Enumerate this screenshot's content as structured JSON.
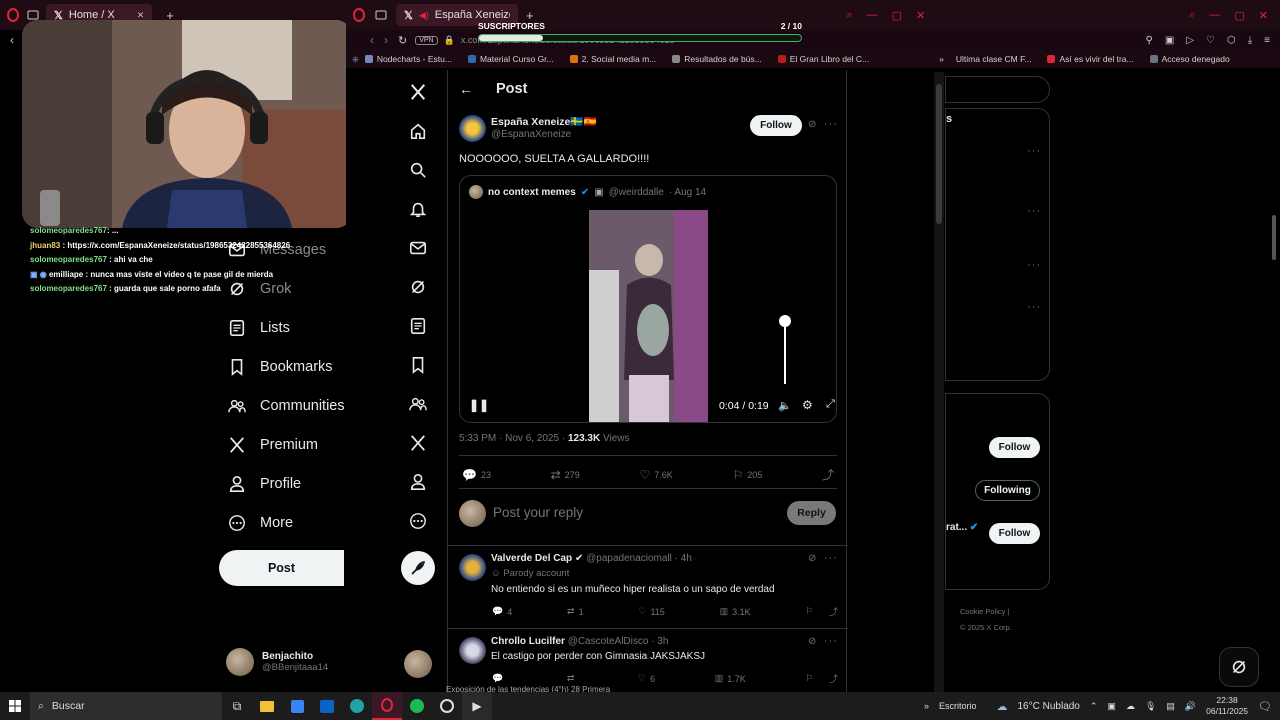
{
  "left_window": {
    "tab_title": "Home / X",
    "chat": [
      {
        "user": "solomeoparedes767",
        "text": ": ..."
      },
      {
        "user": "jhuan83",
        "text": " : https://x.com/EspanaXeneize/status/1986532422855364826"
      },
      {
        "user": "solomeoparedes767",
        "text": " : ahi va che"
      },
      {
        "user": "emilliape",
        "text": " : nunca mas viste el video q te pase gil de mierda"
      },
      {
        "user": "solomeoparedes767",
        "text": " : guarda que sale porno afafa"
      }
    ],
    "nav": [
      "Messages",
      "Grok",
      "Lists",
      "Bookmarks",
      "Communities",
      "Premium",
      "Profile",
      "More"
    ],
    "post_button": "Post",
    "user": {
      "name": "Benjachito",
      "handle": "@BBenjitaaa14"
    }
  },
  "right_window": {
    "tab_title": "España Xeneize en",
    "url": "x.com/EspanaXeneize/status/1986532422855364826",
    "overlay": {
      "label": "SUSCRIPTORES",
      "count": "2 / 10",
      "progress": 0.2
    },
    "bookmarks": [
      "Nodecharts - Estu...",
      "Material Curso Gr...",
      "2. Social media m...",
      "Resultados de bús...",
      "El Gran Libro del C...",
      "Ultima clase CM F...",
      "Así es vivir del tra...",
      "Acceso denegado"
    ]
  },
  "post": {
    "header_title": "Post",
    "author_name": "España Xeneize🇸🇪🇪🇸",
    "author_handle": "@EspanaXeneize",
    "follow_label": "Follow",
    "text": "NOOOOOO, SUELTA A GALLARDO!!!!",
    "quote": {
      "name": "no context memes",
      "handle": "@weirddalle",
      "date": "· Aug 14"
    },
    "video": {
      "time": "0:04 / 0:19",
      "volume": 1.0
    },
    "timestamp": "5:33 PM · Nov 6, 2025 · ",
    "views_count": "123.3K",
    "views_label": " Views",
    "stats": {
      "replies": "23",
      "reposts": "279",
      "likes": "7.6K",
      "bookmarks": "205"
    },
    "reply_placeholder": "Post your reply",
    "reply_button": "Reply"
  },
  "replies": [
    {
      "name": "Valverde Del Cap",
      "handle": "@papadenaciomall · 4h",
      "badge": "Parody account",
      "text": "No entiendo si es un muñeco hiper realista o un sapo de verdad",
      "replies": "4",
      "reposts": "1",
      "likes": "115",
      "views": "3.1K"
    },
    {
      "name": "Chrollo Lucilfer",
      "handle": "@CascoteAlDisco · 3h",
      "text": "El castigo por perder con Gimnasia JAKSJAKSJ",
      "replies": "",
      "reposts": "",
      "likes": "6",
      "views": "1.7K"
    }
  ],
  "sidebar": {
    "follow_label": "Follow",
    "following_label": "Following",
    "truncated_name": "rat...",
    "footer_links": [
      "Cookie Policy",
      "|",
      "© 2025 X Corp."
    ]
  },
  "taskbar": {
    "search_placeholder": "Buscar",
    "desktop_label": "Escritorio",
    "weather": "16°C  Nublado",
    "time": "22:38",
    "date": "06/11/2025",
    "ticker": "Exposición de las tendencias (4°h) 28 Primera"
  },
  "colors": {
    "accent": "#1d9bf0",
    "browser_frame": "#1f0b14",
    "opera_red": "#e0243b"
  }
}
